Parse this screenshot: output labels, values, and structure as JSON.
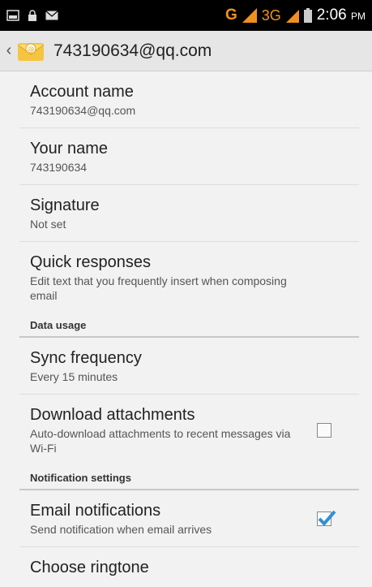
{
  "status_bar": {
    "network": "G",
    "network2": "3G",
    "time": "2:06",
    "ampm": "PM"
  },
  "action_bar": {
    "title": "743190634@qq.com"
  },
  "prefs": [
    {
      "title": "Account name",
      "summary": "743190634@qq.com"
    },
    {
      "title": "Your name",
      "summary": "743190634"
    },
    {
      "title": "Signature",
      "summary": "Not set"
    },
    {
      "title": "Quick responses",
      "summary": "Edit text that you frequently insert when composing email"
    }
  ],
  "category_data": "Data usage",
  "sync": {
    "title": "Sync frequency",
    "summary": "Every 15 minutes"
  },
  "download": {
    "title": "Download attachments",
    "summary": "Auto-download attachments to recent messages via Wi-Fi",
    "checked": false
  },
  "category_notify": "Notification settings",
  "email_notif": {
    "title": "Email notifications",
    "summary": "Send notification when email arrives",
    "checked": true
  },
  "ringtone": {
    "title": "Choose ringtone"
  },
  "colors": {
    "accent": "#2f8fd6",
    "network": "#f09020"
  }
}
